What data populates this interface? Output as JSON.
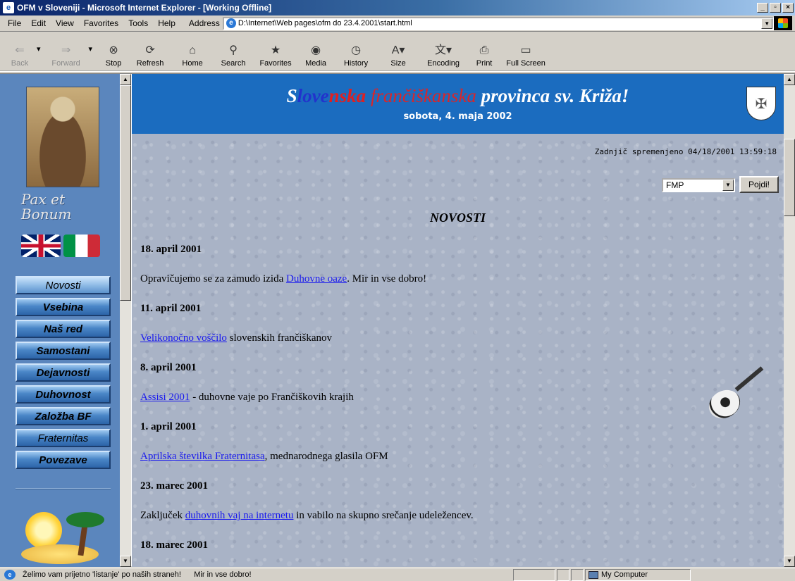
{
  "window": {
    "title": "OFM v Sloveniji - Microsoft Internet Explorer - [Working Offline]",
    "controls": [
      "_",
      "▫",
      "×"
    ]
  },
  "menubar": {
    "items": [
      "File",
      "Edit",
      "View",
      "Favorites",
      "Tools",
      "Help"
    ],
    "address_label": "Address",
    "address_value": "D:\\Internet\\Web pages\\ofm do 23.4.2001\\start.html"
  },
  "toolbar": {
    "buttons": [
      {
        "label": "Back",
        "icon": "back-arrow-icon",
        "enabled": false
      },
      {
        "label": "Forward",
        "icon": "forward-arrow-icon",
        "enabled": false
      },
      {
        "label": "Stop",
        "icon": "stop-icon",
        "enabled": true
      },
      {
        "label": "Refresh",
        "icon": "refresh-icon",
        "enabled": true
      },
      {
        "label": "Home",
        "icon": "home-icon",
        "enabled": true
      },
      {
        "label": "Search",
        "icon": "search-icon",
        "enabled": true
      },
      {
        "label": "Favorites",
        "icon": "favorites-icon",
        "enabled": true
      },
      {
        "label": "Media",
        "icon": "media-icon",
        "enabled": true
      },
      {
        "label": "History",
        "icon": "history-icon",
        "enabled": true
      },
      {
        "label": "Size",
        "icon": "text-size-icon",
        "enabled": true
      },
      {
        "label": "Encoding",
        "icon": "encoding-icon",
        "enabled": true
      },
      {
        "label": "Print",
        "icon": "print-icon",
        "enabled": true
      },
      {
        "label": "Full Screen",
        "icon": "fullscreen-icon",
        "enabled": true
      }
    ]
  },
  "sidebar": {
    "motto": [
      "Pax et",
      "Bonum"
    ],
    "nav": [
      {
        "label": "Novosti",
        "bold": false,
        "active": true
      },
      {
        "label": "Vsebina",
        "bold": true,
        "active": false
      },
      {
        "label": "Naš red",
        "bold": true,
        "active": false
      },
      {
        "label": "Samostani",
        "bold": true,
        "active": false
      },
      {
        "label": "Dejavnosti",
        "bold": true,
        "active": false
      },
      {
        "label": "Duhovnost",
        "bold": true,
        "active": false
      },
      {
        "label": "Založba BF",
        "bold": true,
        "active": false
      },
      {
        "label": "Fraternitas",
        "bold": false,
        "active": false
      },
      {
        "label": "Povezave",
        "bold": true,
        "active": false
      }
    ]
  },
  "banner": {
    "title_parts": [
      "S",
      "love",
      "nska",
      " frančiškanska",
      " provinca sv. Križa!"
    ],
    "date": "sobota, 4. maja 2002",
    "colors": {
      "background": "#1b6cbf",
      "red": "#d8262a",
      "blue": "#2233cc",
      "white": "#ffffff"
    }
  },
  "main": {
    "last_modified": "Zadnjič spremenjeno 04/18/2001 13:59:18",
    "select_value": "FMP",
    "go_button": "Pojdi!",
    "heading": "NOVOSTI",
    "news": [
      {
        "date": "18. april 2001",
        "pre": "Opravičujemo se za zamudo izida ",
        "link": "Duhovne oaze",
        "post": ". Mir in vse dobro!"
      },
      {
        "date": "11. april 2001",
        "pre": "",
        "link": "Velikonočno voščilo",
        "post": " slovenskih frančiškanov"
      },
      {
        "date": "8. april 2001",
        "pre": "",
        "link": "Assisi 2001",
        "post": " - duhovne vaje po Frančiškovih krajih"
      },
      {
        "date": "1. april 2001",
        "pre": "",
        "link": "Aprilska številka Fraternitasa",
        "post": ", mednarodnega glasila OFM"
      },
      {
        "date": "23. marec 2001",
        "pre": "Zaključek ",
        "link": "duhovnih vaj na internetu",
        "post": " in vabilo na skupno srečanje udeležencev."
      },
      {
        "date": "18. marec 2001",
        "pre": "",
        "link": "",
        "post": ""
      }
    ]
  },
  "statusbar": {
    "text": "Želimo vam prijetno 'listanje' po naših straneh!      Mir in vse dobro!",
    "zone": "My Computer"
  }
}
